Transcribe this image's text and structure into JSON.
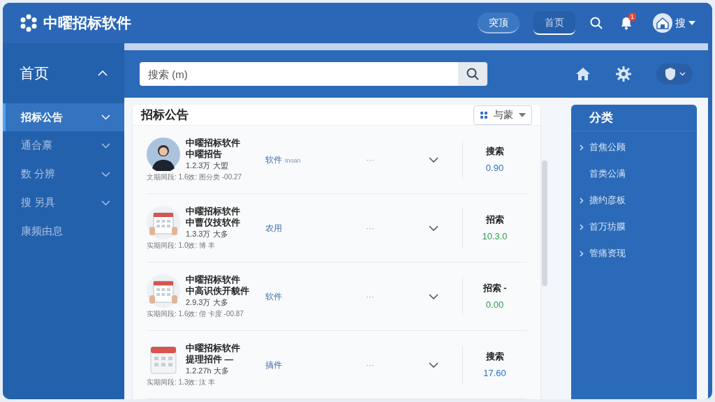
{
  "app": {
    "title": "中曜招标软件"
  },
  "nav_tabs": [
    {
      "label": "突顶",
      "selected": false
    },
    {
      "label": "首页",
      "selected": true
    }
  ],
  "notifications": {
    "badge": "1"
  },
  "user": {
    "name": "搜"
  },
  "sidebar": {
    "title": "首页",
    "expanded": true,
    "items": [
      {
        "label": "招标公告",
        "selected": true,
        "expandable": true
      },
      {
        "label": "通合禀",
        "selected": false,
        "expandable": true
      },
      {
        "label": "数 分辨",
        "selected": false,
        "expandable": true
      },
      {
        "label": "搜 另具",
        "selected": false,
        "expandable": true
      },
      {
        "label": "康频由息",
        "selected": false,
        "expandable": false
      }
    ]
  },
  "search": {
    "placeholder": "搜索 (m)"
  },
  "list": {
    "title": "招标公告",
    "filter": "与蒙",
    "rows": [
      {
        "kind": "person",
        "title": "中曜招标软件",
        "subtitle": "中曜招告",
        "info": "1.2.3万 大盟",
        "meta": "文期间段: 1.6效: 图分类 -00.27",
        "tag": "软件",
        "tag_note": "Inoan",
        "more": "···",
        "right_label": "搜索",
        "value": "0.90",
        "color": "#2f6fc0"
      },
      {
        "kind": "calendar-hands",
        "title": "中曜招标软件",
        "subtitle": "中曹仪技软件",
        "info": "1.3.3万 大多",
        "meta": "实期间段: 1.0效: 博 丰",
        "tag": "农用",
        "more": "···",
        "right_label": "招索",
        "value": "10.3.0",
        "color": "#2e9a4e"
      },
      {
        "kind": "calendar-hands",
        "title": "中曜招标软件",
        "subtitle": "中高识佚开貌件",
        "info": "2.9.3万 大多",
        "meta": "实期间段: 1.6效: 偕 卡度 -00.87",
        "tag": "软件",
        "more": "···",
        "right_label": "招索 -",
        "value": "0.00",
        "color": "#2e9a4e"
      },
      {
        "kind": "calendar",
        "title": "中曜招标软件",
        "subtitle": "提理招件 —",
        "info": "1.2.27h 大多",
        "meta": "实期间段: 1.3效: 汰 丰",
        "tag": "搞件",
        "more": "···",
        "right_label": "搜索",
        "value": "17.60",
        "color": "#2f6fc0"
      }
    ]
  },
  "categories": {
    "title": "分类",
    "items": [
      {
        "label": "首焦公顾",
        "expandable": true
      },
      {
        "label": "首类公满",
        "expandable": false
      },
      {
        "label": "搪约彦板",
        "expandable": true
      },
      {
        "label": "首万坊膜",
        "expandable": true
      },
      {
        "label": "管痛资现",
        "expandable": true
      }
    ]
  }
}
